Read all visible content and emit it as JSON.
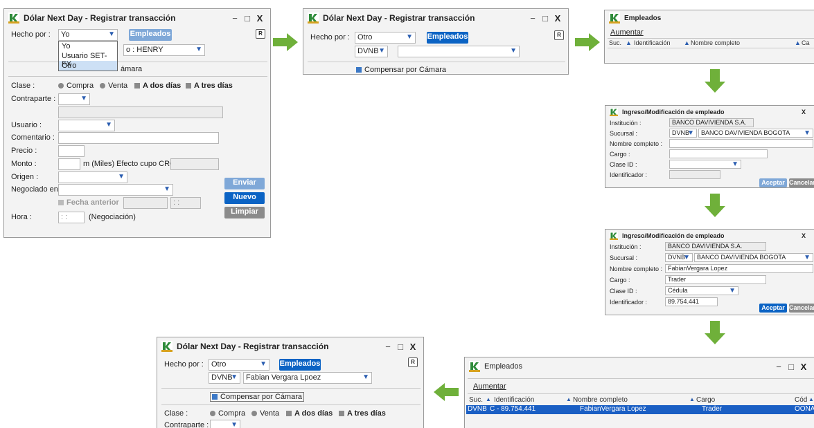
{
  "w1": {
    "title": "Dólar Next Day - Registrar transacción",
    "min": "−",
    "max": "□",
    "close": "X",
    "hecho_por_label": "Hecho por :",
    "hecho_por_value": "Yo",
    "empleados_btn": "Empleados",
    "dropdown_options": [
      "Yo",
      "Usuario SET-FX",
      "Otro"
    ],
    "partial_label": "o : HENRY",
    "camara_partial": "ámara",
    "clase_label": "Clase :",
    "compra": "Compra",
    "venta": "Venta",
    "a_dos_dias": "A dos días",
    "a_tres_dias": "A tres días",
    "contraparte_label": "Contraparte :",
    "usuario_label": "Usuario :",
    "comentario_label": "Comentario :",
    "precio_label": "Precio :",
    "monto_label": "Monto :",
    "miles_label": "m (Miles)",
    "efecto_label": "Efecto cupo CRC :",
    "origen_label": "Origen :",
    "negociado_label": "Negociado en :",
    "enviar_btn": "Enviar",
    "nuevo_btn": "Nuevo",
    "limpiar_btn": "Limpiar",
    "fecha_anterior": "Fecha anterior",
    "time_placeholder": ": :",
    "hora_label": "Hora :",
    "negociacion_label": "(Negociación)"
  },
  "w2": {
    "title": "Dólar Next Day - Registrar transacción",
    "min": "−",
    "max": "□",
    "close": "X",
    "hecho_por_label": "Hecho por :",
    "hecho_por_value": "Otro",
    "empleados_btn": "Empleados",
    "sucursal_value": "DVNB",
    "compensar": "Compensar por Cámara"
  },
  "w3": {
    "title": "Empleados",
    "aumentar": "Aumentar",
    "col_suc": "Suc.",
    "col_id": "Identificación",
    "col_nombre": "Nombre completo",
    "col_cargo": "Ca"
  },
  "w4": {
    "title": "Ingreso/Modificación de empleado",
    "close": "X",
    "institucion_label": "Institución :",
    "institucion_value": "BANCO DAVIVIENDA S.A.",
    "sucursal_label": "Sucursal :",
    "sucursal_code": "DVNB",
    "sucursal_name": "BANCO DAVIVIENDA BOGOTA",
    "nombre_label": "Nombre completo :",
    "cargo_label": "Cargo :",
    "claseid_label": "Clase ID :",
    "identificador_label": "Identificador :",
    "aceptar": "Aceptar",
    "cancelar": "Cancelar"
  },
  "w5": {
    "title": "Ingreso/Modificación de empleado",
    "close": "X",
    "institucion_label": "Institución :",
    "institucion_value": "BANCO DAVIVIENDA S.A.",
    "sucursal_label": "Sucursal :",
    "sucursal_code": "DVNB",
    "sucursal_name": "BANCO DAVIVIENDA BOGOTA",
    "nombre_label": "Nombre completo :",
    "nombre_value": "FabianVergara Lopez",
    "cargo_label": "Cargo :",
    "cargo_value": "Trader",
    "claseid_label": "Clase ID :",
    "claseid_value": "Cédula",
    "identificador_label": "Identificador :",
    "identificador_value": "89.754.441",
    "aceptar": "Aceptar",
    "cancelar": "Cancelar"
  },
  "w6": {
    "title": "Empleados",
    "min": "−",
    "max": "□",
    "close": "X",
    "aumentar": "Aumentar",
    "col_suc": "Suc.",
    "col_id": "Identificación",
    "col_nombre": "Nombre completo",
    "col_cargo": "Cargo",
    "col_cod": "Cód",
    "row": {
      "suc": "DVNB",
      "id": "C - 89.754.441",
      "nombre": "FabianVergara Lopez",
      "cargo": "Trader",
      "cod": "OONA"
    }
  },
  "w7": {
    "title": "Dólar Next Day - Registrar transacción",
    "min": "−",
    "max": "□",
    "close": "X",
    "hecho_por_label": "Hecho por :",
    "hecho_por_value": "Otro",
    "empleados_btn": "Empleados",
    "sucursal_value": "DVNB",
    "empleado_value": "Fabian Vergara Lpoez",
    "compensar": "Compensar por Cámara",
    "clase_label": "Clase :",
    "compra": "Compra",
    "venta": "Venta",
    "a_dos_dias": "A dos días",
    "a_tres_dias": "A tres días",
    "contraparte_label": "Contraparte :"
  },
  "colors": {
    "arrow": "#6fb03a",
    "primary": "#0b63c4",
    "selected_row": "#1a5fc4"
  },
  "icons": {
    "logo": "app-logo-icon",
    "report": "report-icon",
    "arrow": "green-arrow-icon"
  }
}
